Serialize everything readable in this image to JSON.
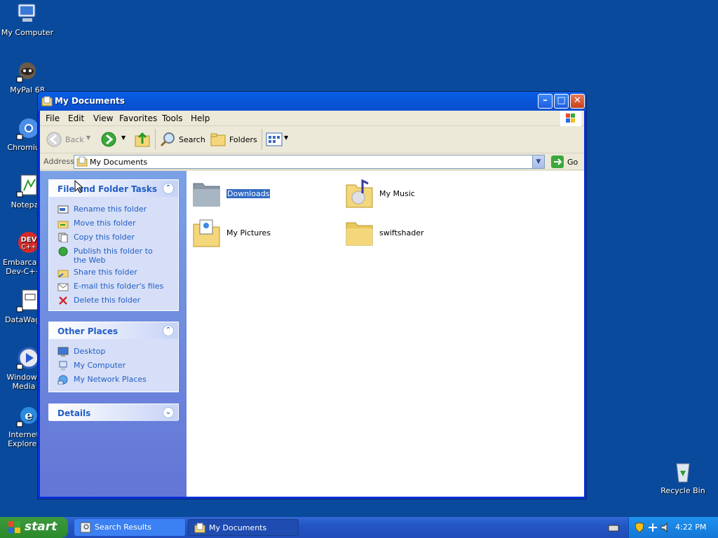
{
  "desktop": {
    "icons": [
      {
        "label": "My Computer"
      },
      {
        "label": "MyPal 68"
      },
      {
        "label": "Chromium"
      },
      {
        "label": "Notepad"
      },
      {
        "label": "Embarcadero Dev-C++"
      },
      {
        "label": "DataWagon"
      },
      {
        "label": "Windows Media Player"
      },
      {
        "label": "Internet Explorer"
      },
      {
        "label": "Recycle Bin"
      }
    ]
  },
  "window": {
    "title": "My Documents",
    "menu": [
      "File",
      "Edit",
      "View",
      "Favorites",
      "Tools",
      "Help"
    ],
    "toolbar": {
      "back": "Back",
      "search": "Search",
      "folders": "Folders"
    },
    "address": {
      "label": "Address",
      "value": "My Documents",
      "go": "Go"
    },
    "tasks_panel": {
      "title": "File and Folder Tasks",
      "items": [
        "Rename this folder",
        "Move this folder",
        "Copy this folder",
        "Publish this folder to the Web",
        "Share this folder",
        "E-mail this folder's files",
        "Delete this folder"
      ]
    },
    "places_panel": {
      "title": "Other Places",
      "items": [
        "Desktop",
        "My Computer",
        "My Network Places"
      ]
    },
    "details_panel": {
      "title": "Details"
    },
    "files": [
      {
        "name": "Downloads",
        "selected": true
      },
      {
        "name": "My Music"
      },
      {
        "name": "My Pictures"
      },
      {
        "name": "swiftshader"
      }
    ]
  },
  "taskbar": {
    "start": "start",
    "buttons": [
      "Search Results",
      "My Documents"
    ],
    "clock": "4:22 PM"
  },
  "colors": {
    "desktop": "#0a4a9c",
    "link": "#215dc6",
    "selection": "#316ac5"
  }
}
